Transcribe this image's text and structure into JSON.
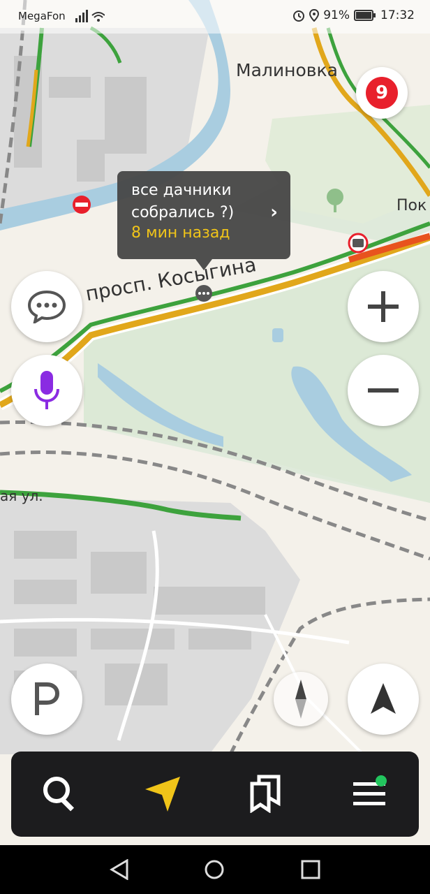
{
  "status": {
    "carrier": "MegaFon",
    "battery": "91%",
    "time": "17:32"
  },
  "map": {
    "labels": {
      "district": "Малиновка",
      "avenue": "просп. Косыгина",
      "street_partial": "ая ул.",
      "edge_partial": "Пок"
    },
    "traffic_level": "9"
  },
  "popup": {
    "message": "все дачники собрались ?)",
    "time_ago": "8 мин назад"
  },
  "bottom_nav": {
    "items": [
      "search-icon",
      "route-arrow-icon",
      "bookmarks-icon",
      "menu-icon"
    ]
  },
  "colors": {
    "accent_yellow": "#f0c419",
    "traffic_red": "#e8202c",
    "mic_purple": "#8a2be2",
    "notify_green": "#22c55e"
  }
}
